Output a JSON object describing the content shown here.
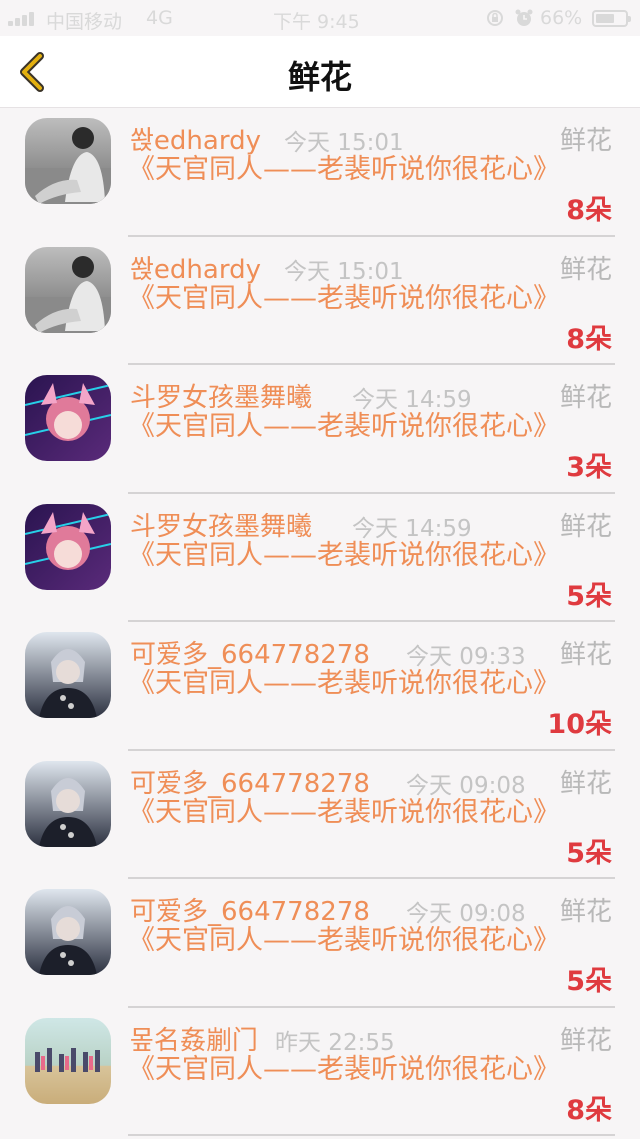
{
  "status_bar": {
    "carrier": "中国移动",
    "network": "4G",
    "time": "下午 9:45",
    "battery": "66%",
    "battery_level": 0.66
  },
  "nav": {
    "title": "鲜花"
  },
  "rows": [
    {
      "name": "쏹edhardy",
      "time": "今天 15:01",
      "label": "鲜花",
      "message": "《天官同人——老裴听说你很花心》",
      "count": "8朵"
    },
    {
      "name": "쏹edhardy",
      "time": "今天 15:01",
      "label": "鲜花",
      "message": "《天官同人——老裴听说你很花心》",
      "count": "8朵"
    },
    {
      "name": "斗罗女孩墨舞曦",
      "time": "今天 14:59",
      "label": "鲜花",
      "message": "《天官同人——老裴听说你很花心》",
      "count": "3朵"
    },
    {
      "name": "斗罗女孩墨舞曦",
      "time": "今天 14:59",
      "label": "鲜花",
      "message": "《天官同人——老裴听说你很花心》",
      "count": "5朵"
    },
    {
      "name": "可爱多_664778278",
      "time": "今天 09:33",
      "label": "鲜花",
      "message": "《天官同人——老裴听说你很花心》",
      "count": "10朵"
    },
    {
      "name": "可爱多_664778278",
      "time": "今天 09:08",
      "label": "鲜花",
      "message": "《天官同人——老裴听说你很花心》",
      "count": "5朵"
    },
    {
      "name": "可爱多_664778278",
      "time": "今天 09:08",
      "label": "鲜花",
      "message": "《天官同人——老裴听说你很花心》",
      "count": "5朵"
    },
    {
      "name": "뫂名姦剻门",
      "time": "昨天 22:55",
      "label": "鲜花",
      "message": "《天官同人——老裴听说你很花心》",
      "count": "8朵"
    }
  ],
  "colors": {
    "accent": "#ef8e57",
    "count": "#df3a3f",
    "muted": "#c4c4c4",
    "back_icon": "#e3b00f"
  },
  "icons": [
    "back-chevron-icon",
    "alarm-icon",
    "lock-rotation-icon",
    "battery-icon",
    "signal-icon"
  ]
}
